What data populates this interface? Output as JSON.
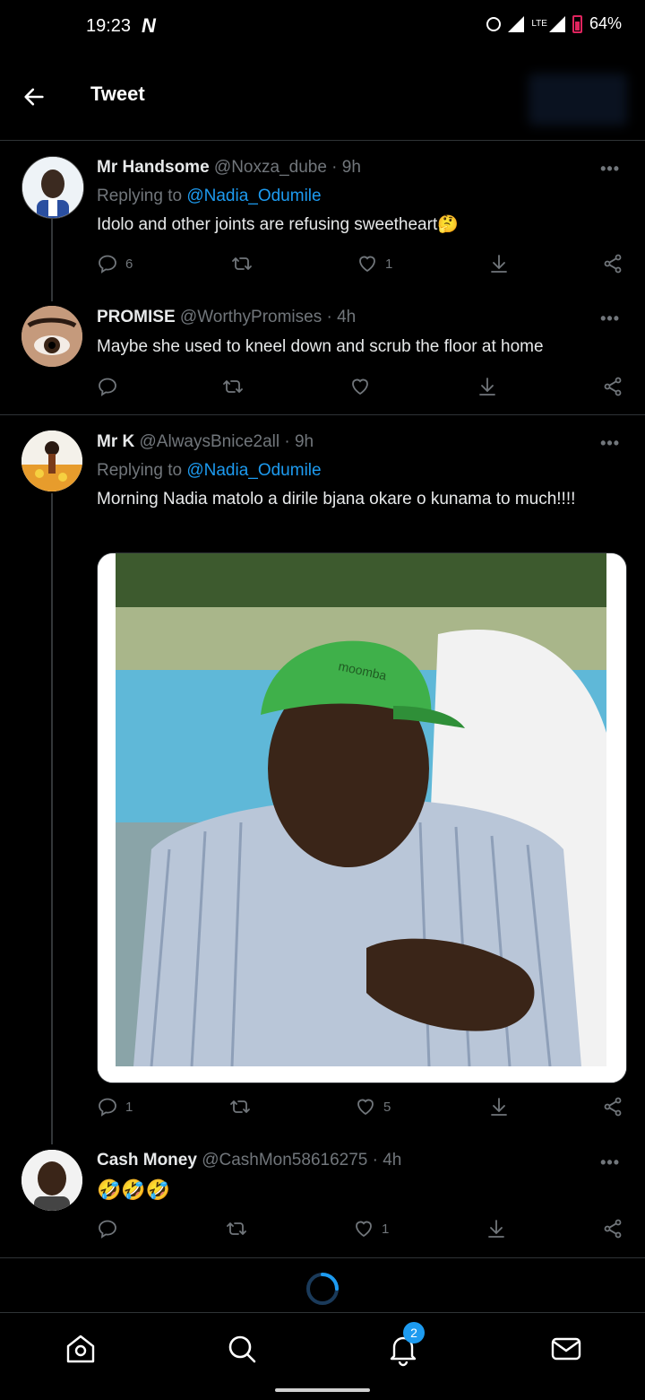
{
  "status": {
    "time": "19:23",
    "n_label": "N",
    "lte": "LTE",
    "battery": "64%"
  },
  "header": {
    "title": "Tweet"
  },
  "tweets": [
    {
      "name": "Mr Handsome",
      "handle": "@Noxza_dube · 9h",
      "replying_prefix": "Replying to ",
      "replying_to": "@Nadia_Odumile",
      "text": "Idolo and other joints are refusing sweetheart🤔",
      "replies": "6",
      "retweets": "",
      "likes": "1"
    },
    {
      "name": "PROMISE",
      "handle": "@WorthyPromises · 4h",
      "text": "Maybe she used to kneel down and scrub the floor at home",
      "replies": "",
      "retweets": "",
      "likes": ""
    },
    {
      "name": "Mr K",
      "handle": "@AlwaysBnice2all · 9h",
      "replying_prefix": "Replying to ",
      "replying_to": "@Nadia_Odumile",
      "text": "Morning  Nadia matolo a dirile bjana okare o kunama to much!!!!",
      "cap_text": "moomba",
      "replies": "1",
      "retweets": "",
      "likes": "5"
    },
    {
      "name": "Cash Money",
      "handle": "@CashMon58616275 · 4h",
      "text": "🤣🤣🤣",
      "replies": "",
      "retweets": "",
      "likes": "1"
    }
  ],
  "more_label": "•••",
  "nav": {
    "notifications_badge": "2"
  },
  "colors": {
    "accent": "#1d9bf0",
    "muted": "#71767b",
    "bg": "#000000",
    "border": "#2f3336"
  }
}
